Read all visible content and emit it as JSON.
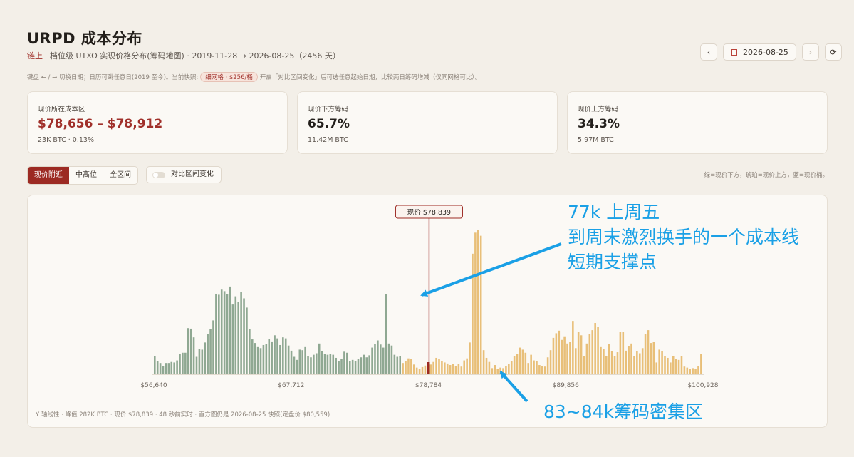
{
  "header": {
    "title": "URPD 成本分布",
    "chain_tag": "链上",
    "subtitle": "档位级 UTXO 实现价格分布(筹码地图) · 2019-11-28 → 2026-08-25（2456 天）",
    "hint_before": "键盘 ← / → 切换日期；日历可跳任意日(2019 至今)。当前快照:",
    "hint_pill": "细网格 · $256/桶",
    "hint_after": "开启「对比区间变化」后可选任意起始日期，比较两日筹码增减（仅同网格可比）。"
  },
  "nav": {
    "prev_icon": "‹",
    "date": "2026-08-25",
    "next_icon": "›",
    "refresh_icon": "⟳"
  },
  "cards": [
    {
      "label": "现价所在成本区",
      "value": "$78,656 – $78,912",
      "sub": "23K BTC · 0.13%"
    },
    {
      "label": "现价下方筹码",
      "value": "65.7%",
      "sub": "11.42M BTC"
    },
    {
      "label": "现价上方筹码",
      "value": "34.3%",
      "sub": "5.97M BTC"
    }
  ],
  "range_tabs": [
    "现价附近",
    "中高位",
    "全区间"
  ],
  "compare_toggle": "对比区间变化",
  "legend_note": "绿=现价下方，琥珀=现价上方，蓝=现价桶。",
  "footnote": "Y 轴线性 · 峰值 282K BTC · 现价 $78,839 · 48 秒前实时 · 直方图仍是 2026-08-25 快照(定盘价 $80,559)",
  "annotations": {
    "top": [
      "77k 上周五",
      "到周末激烈换手的一个成本线",
      "短期支撑点"
    ],
    "bottom": "83~84k筹码密集区"
  },
  "colors": {
    "below": "#8fa892",
    "above": "#e8bf78",
    "current": "#9c2a23",
    "annotation": "#1aa0e6"
  },
  "chart_data": {
    "type": "bar",
    "x_unit": "USD price bucket",
    "xlim": [
      56640,
      100928
    ],
    "x_ticks": [
      {
        "value": 56640,
        "label": "$56,640"
      },
      {
        "value": 67712,
        "label": "$67,712"
      },
      {
        "value": 78784,
        "label": "$78,784"
      },
      {
        "value": 89856,
        "label": "$89,856"
      },
      {
        "value": 100928,
        "label": "$100,928"
      }
    ],
    "current_price": 78839,
    "current_label": "现价 $78,839",
    "peak_btc": 282000,
    "heights": [
      36,
      25,
      22,
      16,
      22,
      22,
      24,
      23,
      27,
      40,
      42,
      42,
      90,
      89,
      72,
      34,
      50,
      48,
      62,
      78,
      88,
      105,
      157,
      155,
      165,
      162,
      156,
      171,
      136,
      152,
      141,
      160,
      148,
      130,
      88,
      68,
      61,
      53,
      51,
      57,
      59,
      69,
      64,
      76,
      70,
      57,
      72,
      70,
      56,
      46,
      34,
      28,
      48,
      47,
      53,
      35,
      33,
      38,
      41,
      60,
      45,
      39,
      38,
      40,
      38,
      32,
      26,
      30,
      44,
      42,
      26,
      28,
      26,
      30,
      33,
      38,
      33,
      37,
      52,
      59,
      66,
      58,
      52,
      156,
      60,
      56,
      38,
      34,
      35,
      22,
      25,
      31,
      30,
      19,
      13,
      11,
      14,
      17,
      18,
      19,
      24,
      32,
      30,
      25,
      23,
      21,
      18,
      20,
      16,
      20,
      15,
      27,
      31,
      62,
      235,
      276,
      282,
      270,
      47,
      32,
      24,
      12,
      18,
      10,
      13,
      12,
      16,
      20,
      26,
      35,
      40,
      52,
      48,
      42,
      22,
      38,
      27,
      26,
      18,
      16,
      15,
      33,
      47,
      71,
      80,
      85,
      67,
      74,
      60,
      63,
      104,
      51,
      82,
      76,
      35,
      60,
      78,
      86,
      100,
      93,
      53,
      50,
      35,
      59,
      45,
      35,
      43,
      82,
      83,
      46,
      55,
      60,
      35,
      45,
      41,
      51,
      79,
      86,
      61,
      63,
      23,
      48,
      45,
      36,
      32,
      23,
      36,
      30,
      28,
      35,
      15,
      13,
      10,
      12,
      11,
      16,
      40
    ],
    "below_count": 89
  }
}
